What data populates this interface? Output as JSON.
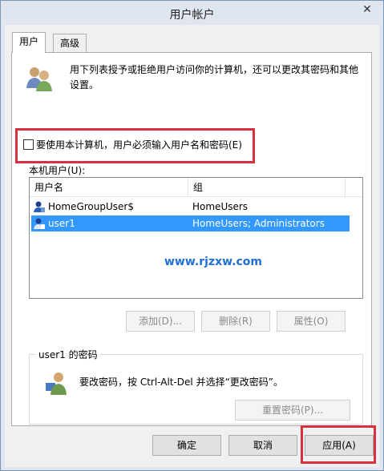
{
  "window": {
    "title": "用户帐户",
    "close_glyph": "✕"
  },
  "tabs": [
    {
      "label": "用户"
    },
    {
      "label": "高级"
    }
  ],
  "description": "用下列表授予或拒绝用户访问你的计算机，还可以更改其密码和其他设置。",
  "require_login_checkbox": {
    "label": "要使用本计算机，用户必须输入用户名和密码(E)",
    "checked": false
  },
  "users_section_label": "本机用户(U):",
  "users_table": {
    "columns": [
      "用户名",
      "组"
    ],
    "rows": [
      {
        "name": "HomeGroupUser$",
        "group": "HomeUsers",
        "selected": false
      },
      {
        "name": "user1",
        "group": "HomeUsers; Administrators",
        "selected": true
      }
    ]
  },
  "watermark": "www.rjzxw.com",
  "list_buttons": {
    "add": "添加(D)...",
    "remove": "删除(R)",
    "properties": "属性(O)"
  },
  "password_group": {
    "title": "user1 的密码",
    "text": "要改密码，按 Ctrl-Alt-Del 并选择“更改密码”。",
    "reset_button": "重置密码(P)..."
  },
  "footer": {
    "ok": "确定",
    "cancel": "取消",
    "apply": "应用(A)"
  },
  "colors": {
    "selection": "#3399ff",
    "highlight_box": "#d9303f",
    "watermark": "#1f6fd8"
  }
}
